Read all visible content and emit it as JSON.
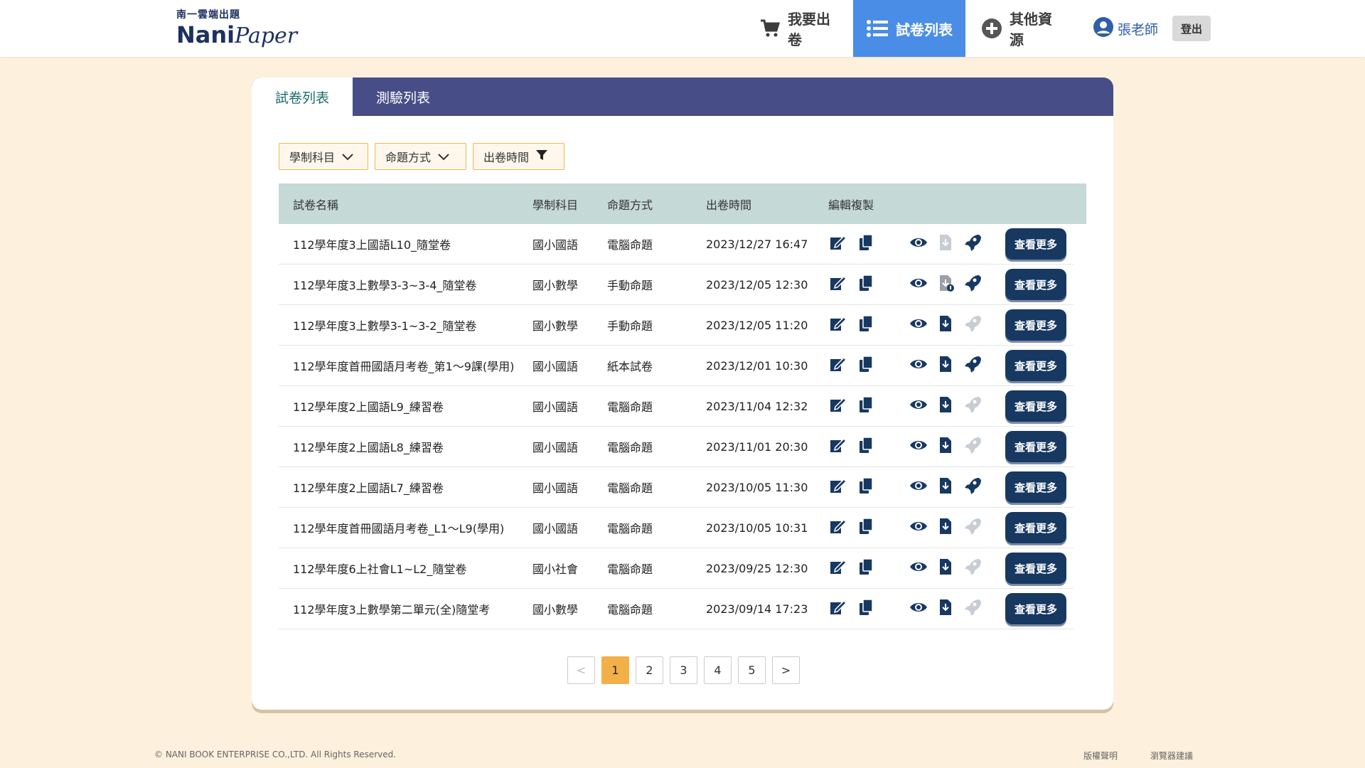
{
  "brand": {
    "sub": "南一雲端出題",
    "name_a": "Nani",
    "name_b": "Paper"
  },
  "nav": {
    "make_label": "我要出卷",
    "list_label": "試卷列表",
    "other_label": "其他資源",
    "user_name": "張老師",
    "logout_label": "登出"
  },
  "tabs": {
    "paper_list": "試卷列表",
    "test_list": "測驗列表"
  },
  "filters": {
    "subject": "學制科目",
    "mode": "命題方式",
    "time": "出卷時間"
  },
  "table": {
    "headers": {
      "name": "試卷名稱",
      "subject": "學制科目",
      "mode": "命題方式",
      "time": "出卷時間",
      "edit": "編輯複製"
    },
    "more_label": "查看更多",
    "rows": [
      {
        "name": "112學年度3上國語L10_隨堂卷",
        "subject": "國小國語",
        "mode": "電腦命題",
        "time": "2023/12/27 16:47",
        "download": "disabled",
        "rocket": "active"
      },
      {
        "name": "112學年度3上數學3-3~3-4_隨堂卷",
        "subject": "國小數學",
        "mode": "手動命題",
        "time": "2023/12/05 12:30",
        "download": "info",
        "rocket": "active"
      },
      {
        "name": "112學年度3上數學3-1~3-2_隨堂卷",
        "subject": "國小數學",
        "mode": "手動命題",
        "time": "2023/12/05 11:20",
        "download": "active",
        "rocket": "disabled"
      },
      {
        "name": "112學年度首冊國語月考卷_第1～9課(學用)",
        "subject": "國小國語",
        "mode": "紙本試卷",
        "time": "2023/12/01 10:30",
        "download": "active",
        "rocket": "active"
      },
      {
        "name": "112學年度2上國語L9_練習卷",
        "subject": "國小國語",
        "mode": "電腦命題",
        "time": "2023/11/04 12:32",
        "download": "active",
        "rocket": "disabled"
      },
      {
        "name": "112學年度2上國語L8_練習卷",
        "subject": "國小國語",
        "mode": "電腦命題",
        "time": "2023/11/01 20:30",
        "download": "active",
        "rocket": "disabled"
      },
      {
        "name": "112學年度2上國語L7_練習卷",
        "subject": "國小國語",
        "mode": "電腦命題",
        "time": "2023/10/05 11:30",
        "download": "active",
        "rocket": "active"
      },
      {
        "name": "112學年度首冊國語月考卷_L1～L9(學用)",
        "subject": "國小國語",
        "mode": "電腦命題",
        "time": "2023/10/05 10:31",
        "download": "active",
        "rocket": "disabled"
      },
      {
        "name": "112學年度6上社會L1~L2_隨堂卷",
        "subject": "國小社會",
        "mode": "電腦命題",
        "time": "2023/09/25 12:30",
        "download": "active",
        "rocket": "disabled"
      },
      {
        "name": "112學年度3上數學第二單元(全)隨堂考",
        "subject": "國小數學",
        "mode": "電腦命題",
        "time": "2023/09/14 17:23",
        "download": "active",
        "rocket": "disabled"
      }
    ]
  },
  "pagination": {
    "prev": "<",
    "next": ">",
    "pages": [
      "1",
      "2",
      "3",
      "4",
      "5"
    ],
    "current": "1"
  },
  "footer": {
    "copyright": "© NANI BOOK ENTERPRISE CO.,LTD. All Rights Reserved.",
    "links": [
      "版權聲明",
      "瀏覽器建議"
    ]
  },
  "colors": {
    "nav_active": "#4a8de6",
    "tab_bar": "#474d86",
    "button_dark": "#173861",
    "accent_orange": "#f2b048",
    "table_head": "#c5d9d7"
  }
}
